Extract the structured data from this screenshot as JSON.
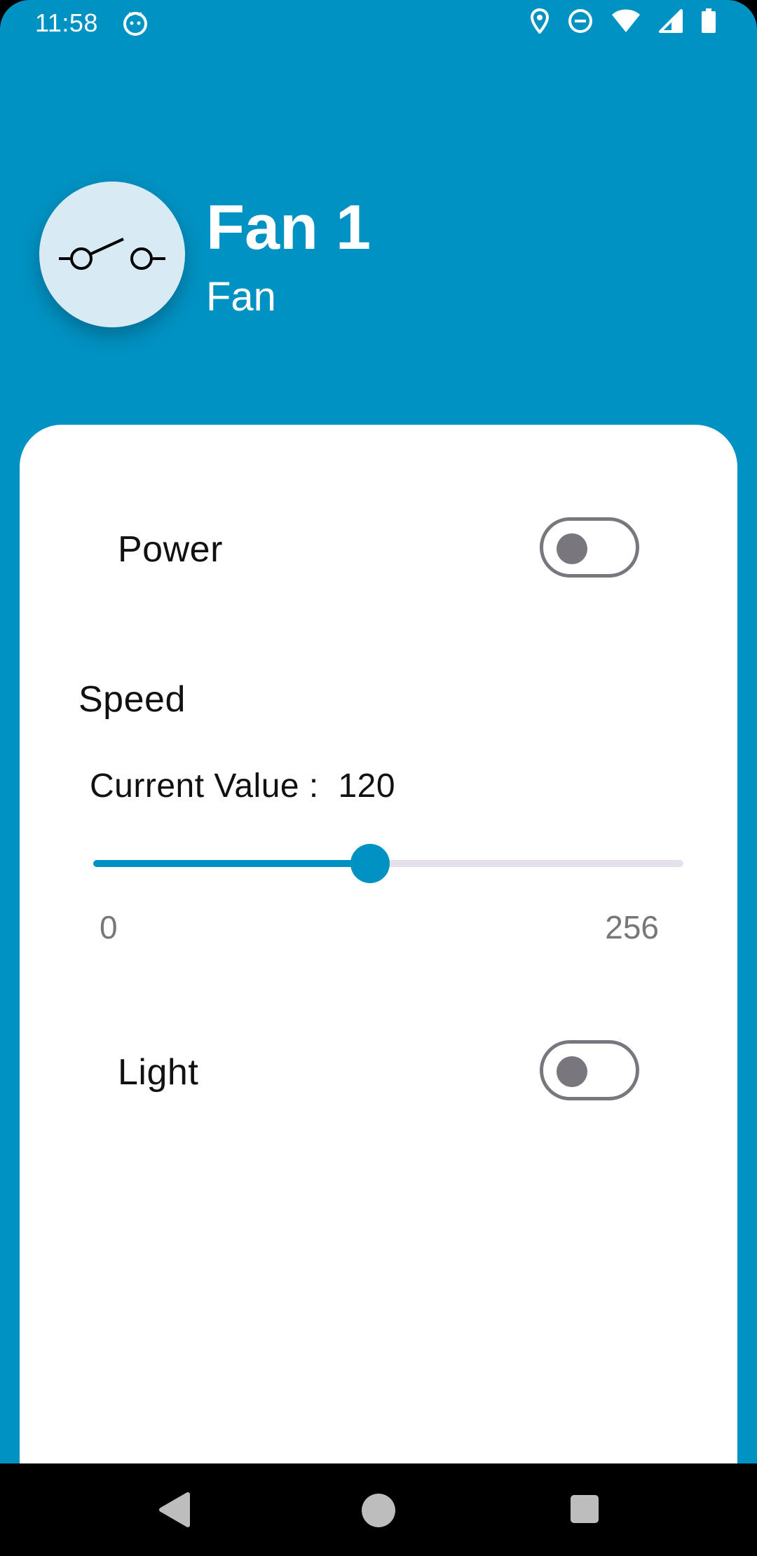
{
  "status_bar": {
    "time": "11:58",
    "left_icon": "cat-icon",
    "right_icons": [
      "location-icon",
      "do-not-disturb-icon",
      "wifi-icon",
      "signal-icon",
      "battery-icon"
    ]
  },
  "header": {
    "device_icon": "switch-icon",
    "device_name": "Fan 1",
    "device_type": "Fan"
  },
  "controls": {
    "power": {
      "label": "Power",
      "on": false
    },
    "speed": {
      "label": "Speed",
      "current_value_label": "Current Value :",
      "value": "120",
      "min": "0",
      "max": "256",
      "fraction": 0.469
    },
    "light": {
      "label": "Light",
      "on": false
    }
  },
  "nav_bar": {
    "back": "back-icon",
    "home": "home-icon",
    "recents": "recents-icon"
  },
  "colors": {
    "primary": "#0092c3",
    "avatar_bg": "#d8eaf4",
    "switch_off": "#7a767e",
    "track_inactive": "#e6e0ec"
  }
}
